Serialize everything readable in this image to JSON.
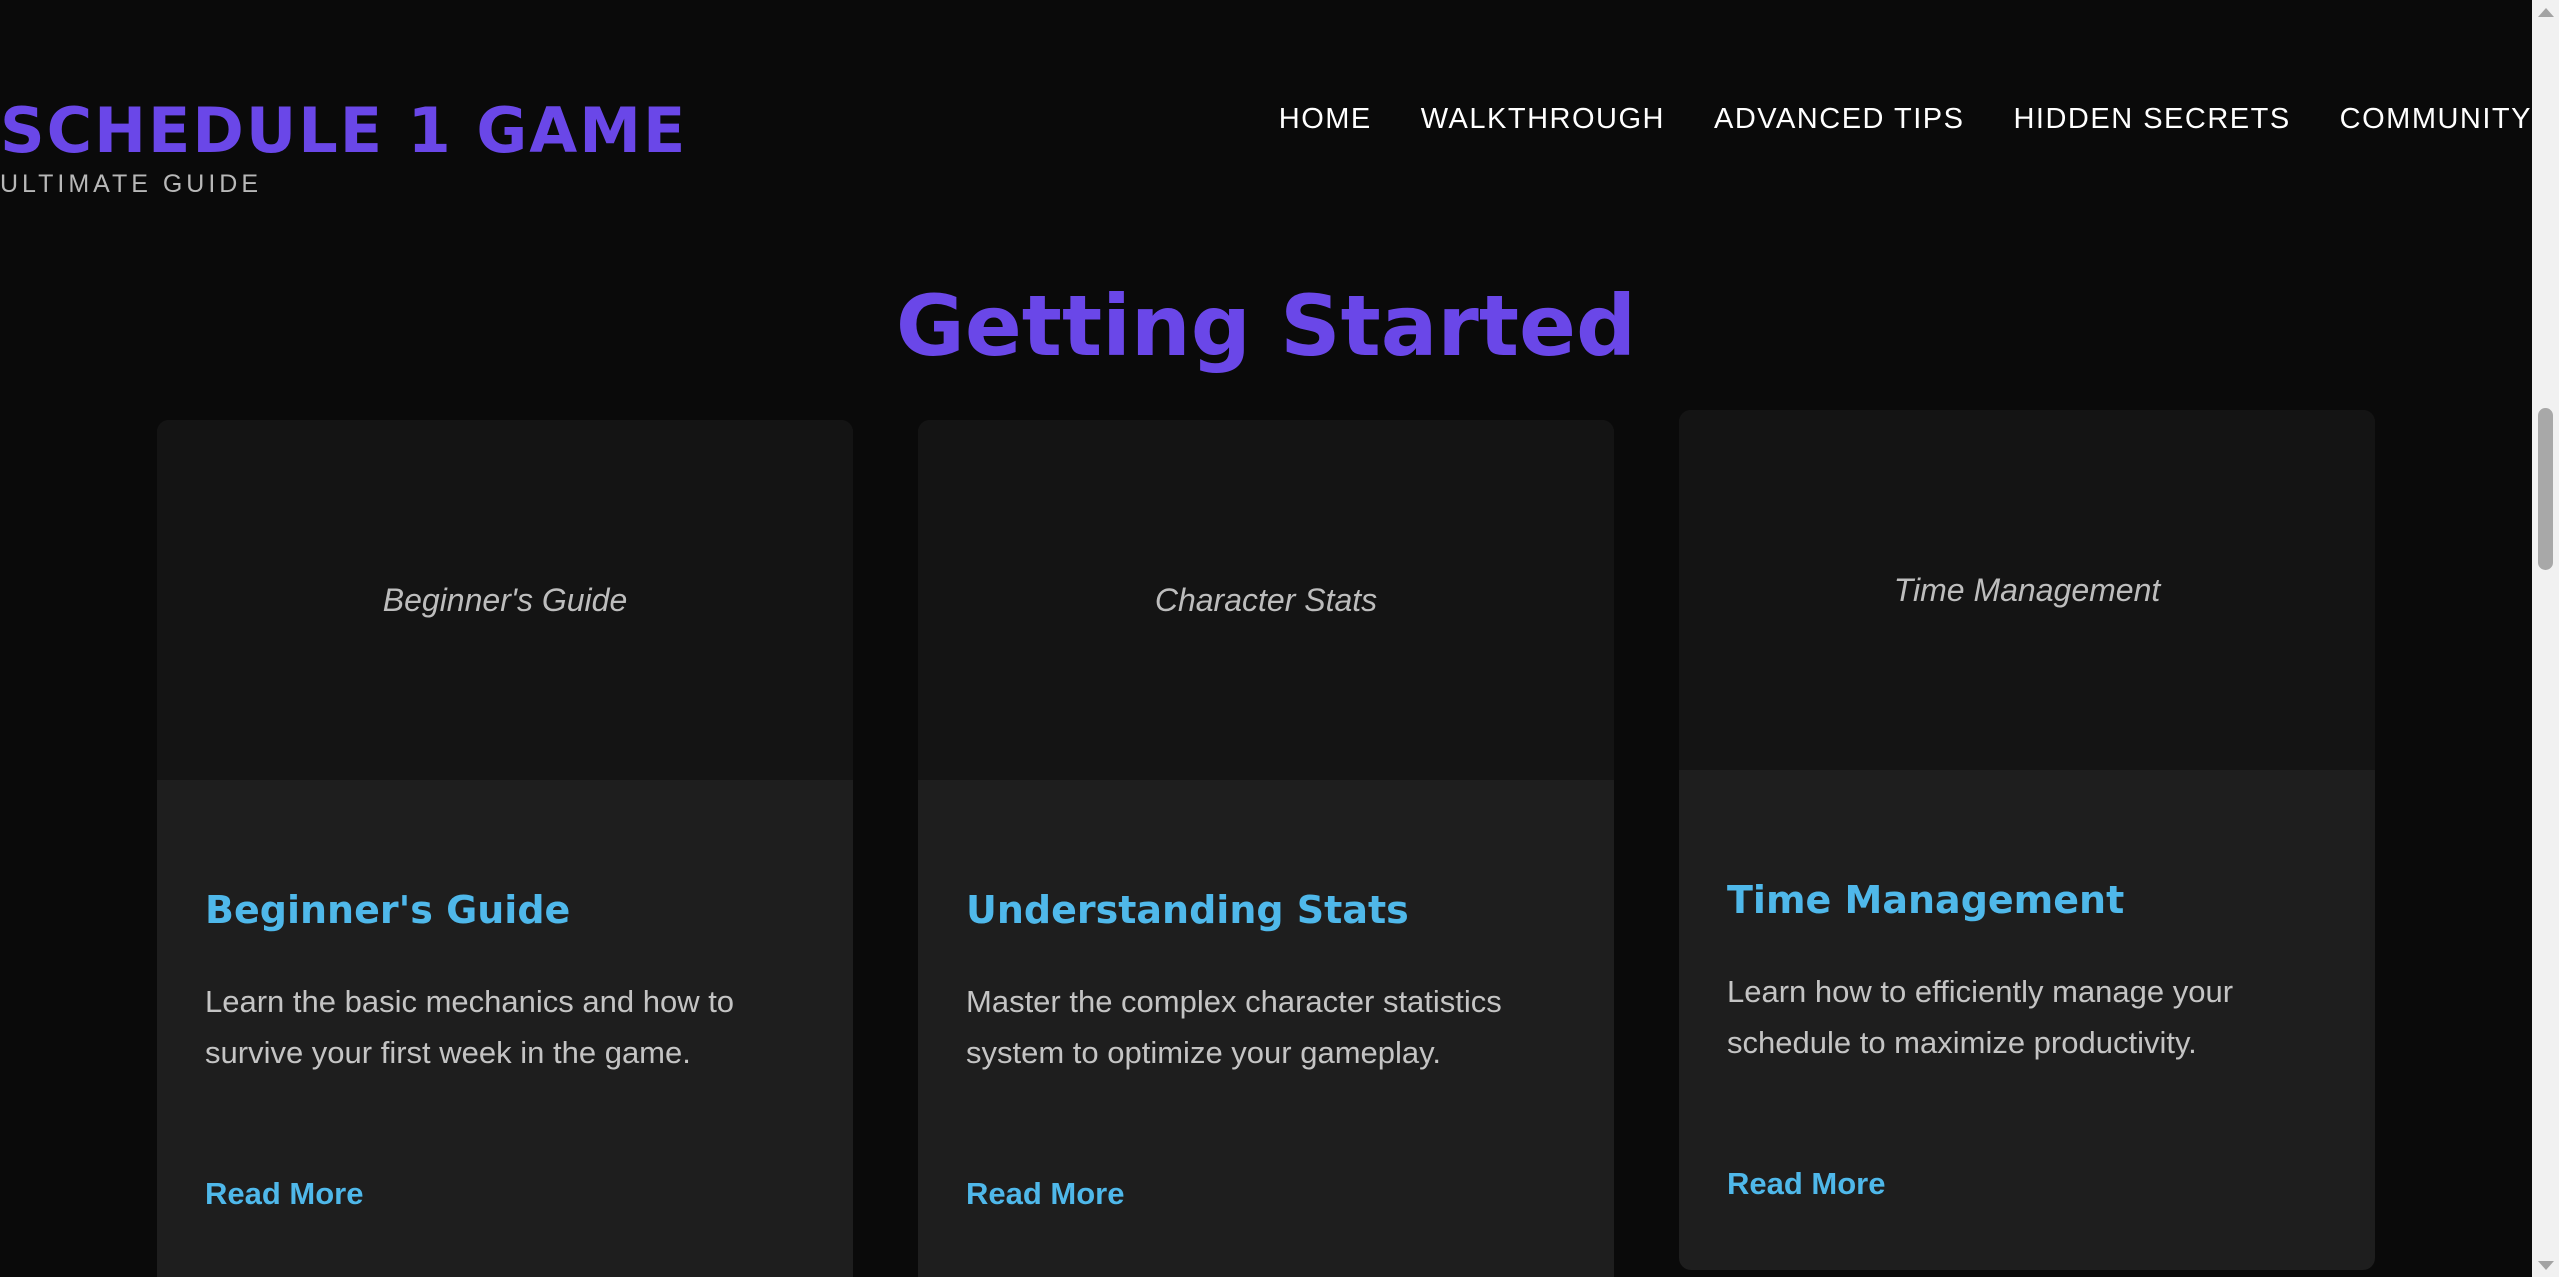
{
  "header": {
    "logo_title": "SCHEDULE 1 GAME",
    "logo_subtitle": "ULTIMATE GUIDE",
    "nav": [
      {
        "label": "HOME"
      },
      {
        "label": "WALKTHROUGH"
      },
      {
        "label": "ADVANCED TIPS"
      },
      {
        "label": "HIDDEN SECRETS"
      },
      {
        "label": "COMMUNITY"
      }
    ]
  },
  "section": {
    "title": "Getting Started",
    "cards": [
      {
        "image_label": "Beginner's Guide",
        "title": "Beginner's Guide",
        "text": "Learn the basic mechanics and how to survive your first week in the game.",
        "link": "Read More"
      },
      {
        "image_label": "Character Stats",
        "title": "Understanding Stats",
        "text": "Master the complex character statistics system to optimize your gameplay.",
        "link": "Read More"
      },
      {
        "image_label": "Time Management",
        "title": "Time Management",
        "text": "Learn how to efficiently manage your schedule to maximize productivity.",
        "link": "Read More"
      }
    ]
  },
  "colors": {
    "background": "#0a0a0a",
    "brand_purple": "#6a47e8",
    "accent_blue": "#4fb8ea",
    "card_background": "#1e1e1e",
    "card_media_background": "#141414"
  }
}
